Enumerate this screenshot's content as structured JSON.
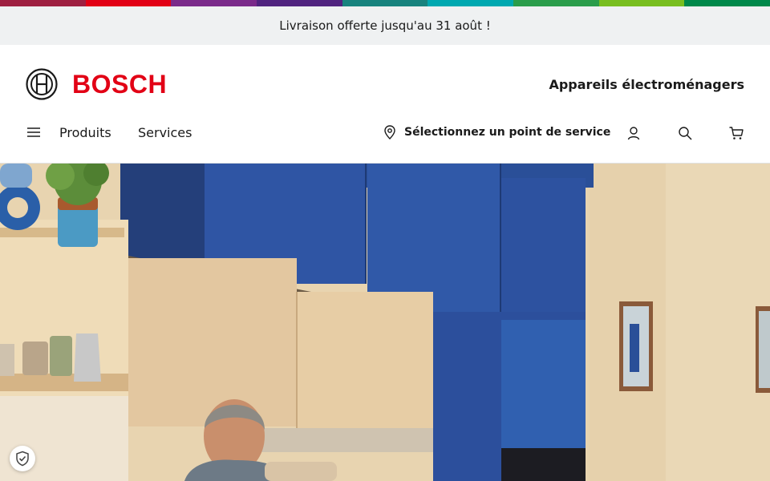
{
  "color_bar": [
    "#9e2041",
    "#e20015",
    "#7a2a8a",
    "#50237f",
    "#18837e",
    "#00a8b0",
    "#2a9d4b",
    "#78be20",
    "#00884a"
  ],
  "promo": {
    "text": "Livraison offerte jusqu'au 31 août !"
  },
  "header": {
    "logo_text": "BOSCH",
    "tagline": "Appareils électroménagers",
    "brand_color": "#e20015"
  },
  "nav": {
    "menu_icon": "hamburger-icon",
    "links": [
      "Produits",
      "Services"
    ],
    "service_point": "Sélectionnez un point de service",
    "icons": [
      "location-pin-icon",
      "user-icon",
      "search-icon",
      "cart-icon"
    ]
  },
  "hero": {
    "image": "kitchen-photo",
    "cabinet_color": "#2f55a4"
  },
  "trust_badge": {
    "icon": "shield-check-icon"
  }
}
